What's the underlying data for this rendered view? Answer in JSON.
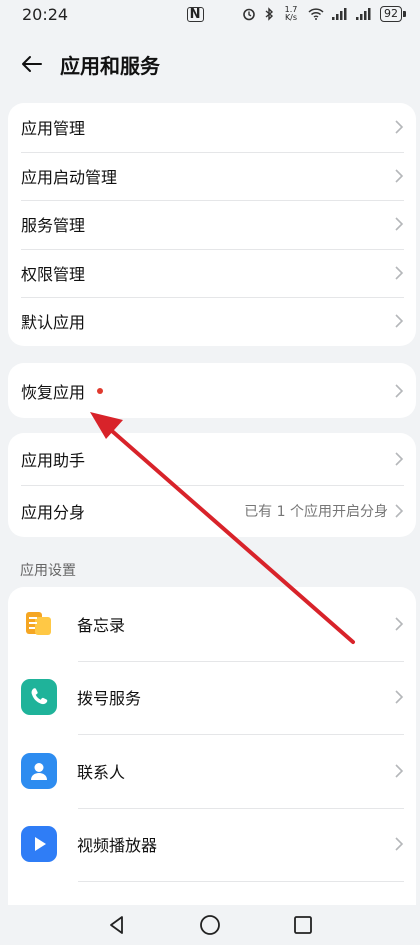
{
  "status_bar": {
    "time": "20:24",
    "nfc_label": "N",
    "net_speed": "1.7 K/s",
    "battery": "92"
  },
  "header": {
    "title": "应用和服务"
  },
  "group1": {
    "items": [
      {
        "label": "应用管理"
      },
      {
        "label": "应用启动管理"
      },
      {
        "label": "服务管理"
      },
      {
        "label": "权限管理"
      },
      {
        "label": "默认应用"
      }
    ]
  },
  "group2": {
    "items": [
      {
        "label": "恢复应用"
      }
    ]
  },
  "group3": {
    "items": [
      {
        "label": "应用助手",
        "value": ""
      },
      {
        "label": "应用分身",
        "value": "已有 1 个应用开启分身"
      }
    ]
  },
  "settings": {
    "section_title": "应用设置",
    "items": [
      {
        "label": "备忘录",
        "icon": "notes-icon",
        "color": "#f5a623"
      },
      {
        "label": "拨号服务",
        "icon": "phone-icon",
        "color": "#1fb39a"
      },
      {
        "label": "联系人",
        "icon": "contacts-icon",
        "color": "#2d8cf0"
      },
      {
        "label": "视频播放器",
        "icon": "video-player-icon",
        "color": "#2f7df6"
      }
    ]
  },
  "colors": {
    "background": "#f1f3f5",
    "annotation_arrow": "#d8232a",
    "red_dot": "#e03a2e"
  }
}
